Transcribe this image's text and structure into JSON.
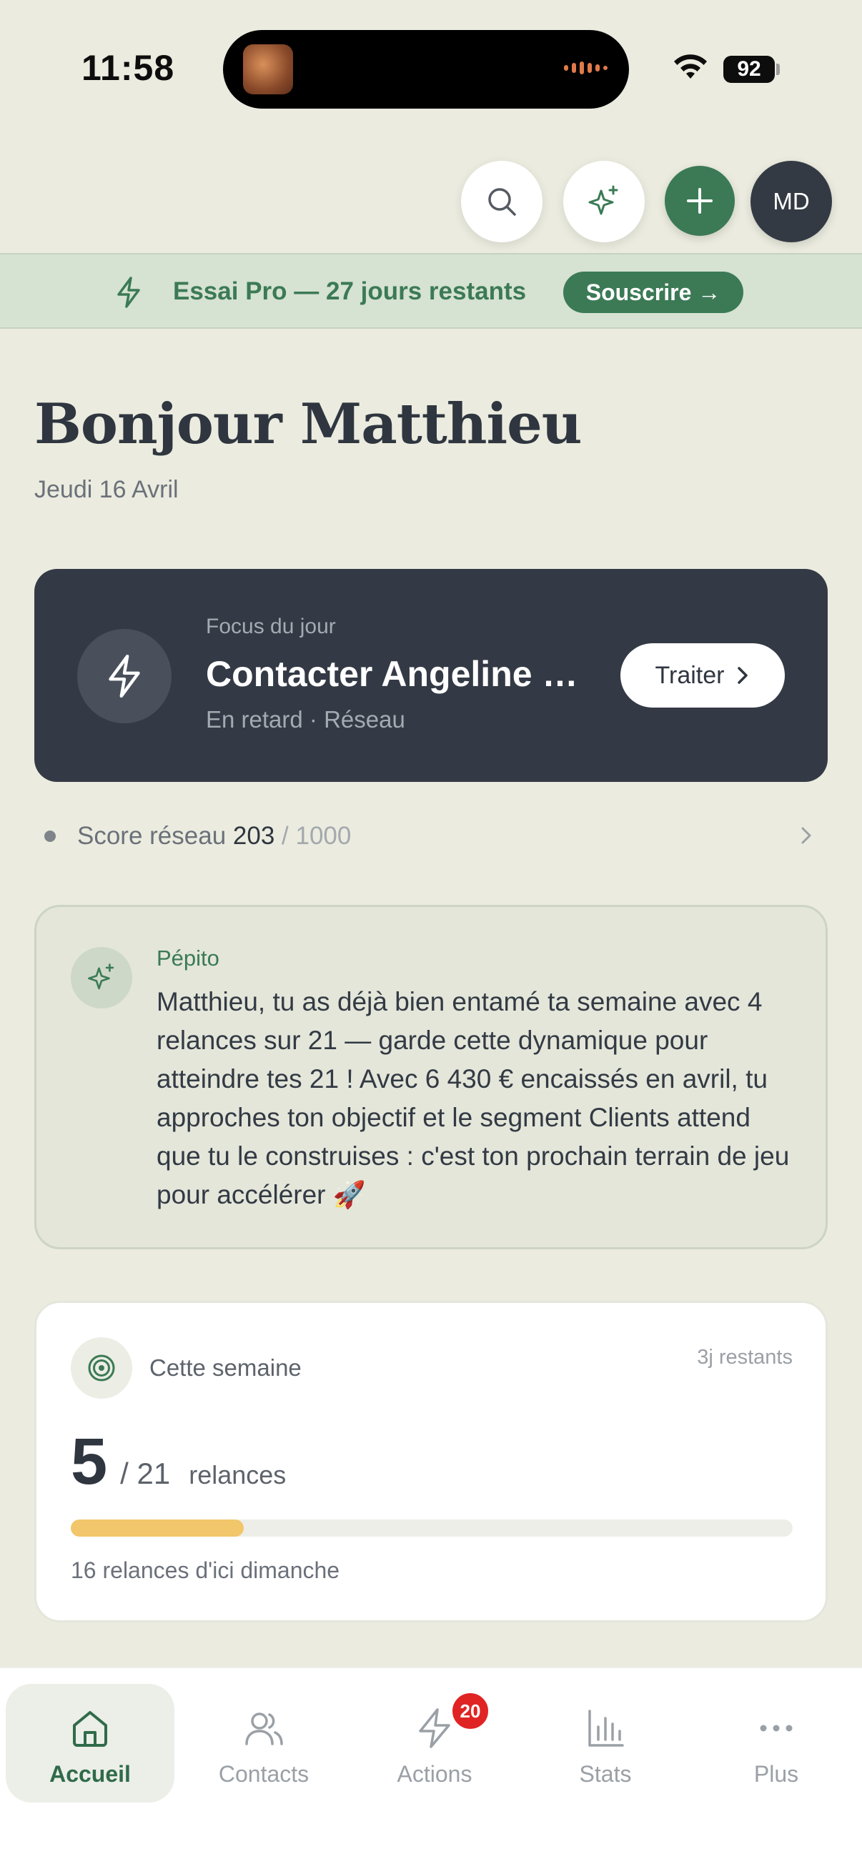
{
  "status_bar": {
    "time": "11:58",
    "battery": "92"
  },
  "header": {
    "avatar_initials": "MD",
    "icons": [
      "search-icon",
      "sparkle-icon",
      "plus-icon"
    ]
  },
  "trial_banner": {
    "text": "Essai Pro — 27 jours restants",
    "cta_label": "Souscrire →"
  },
  "greeting": {
    "title": "Bonjour Matthieu",
    "date": "Jeudi 16 Avril"
  },
  "focus": {
    "kicker": "Focus du jour",
    "title": "Contacter Angeline Martin",
    "subtitle": "En retard · Réseau",
    "action_label": "Traiter"
  },
  "score": {
    "label": "Score réseau",
    "value": "203",
    "max": "/ 1000"
  },
  "pepito": {
    "name": "Pépito",
    "message": "Matthieu, tu as déjà bien entamé ta semaine avec 4 relances sur 21 — garde cette dynamique pour atteindre tes 21 ! Avec 6 430 € encaissés en avril, tu approches ton objectif et le segment Clients attend que tu le construises : c'est ton prochain terrain de jeu pour accélérer 🚀"
  },
  "week": {
    "label": "Cette semaine",
    "remaining": "3j restants",
    "count": "5",
    "total": "/ 21",
    "unit": "relances",
    "progress": 0.24,
    "note": "16 relances d'ici dimanche"
  },
  "nav": {
    "items": [
      {
        "label": "Accueil",
        "icon": "home-icon",
        "active": true
      },
      {
        "label": "Contacts",
        "icon": "contacts-icon"
      },
      {
        "label": "Actions",
        "icon": "bolt-icon",
        "badge": "20"
      },
      {
        "label": "Stats",
        "icon": "bar-chart-icon"
      },
      {
        "label": "Plus",
        "icon": "more-icon"
      }
    ]
  },
  "colors": {
    "accent_green": "#3b7a55",
    "background": "#ebecdf",
    "dark_card": "#343a45",
    "progress_yellow": "#f2c66a",
    "badge_red": "#e02424"
  }
}
